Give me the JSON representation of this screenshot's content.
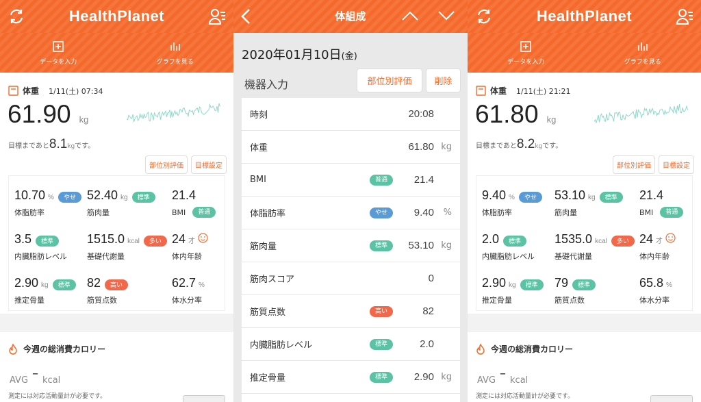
{
  "left": {
    "app_title": "HealthPlanet",
    "tabs": [
      "データを入力",
      "グラフを見る"
    ],
    "weight_label": "体重",
    "weight_time": "1/11(土) 07:34",
    "weight_value": "61.90",
    "weight_unit": "kg",
    "goal_prefix": "目標まであと",
    "goal_value": "8.1",
    "goal_unit": "kg",
    "goal_suffix": "です。",
    "btn_eval": "部位別評価",
    "btn_goal": "目標設定",
    "metrics": [
      {
        "value": "10.70",
        "unit": "%",
        "label": "体脂肪率",
        "badge": "やせ",
        "color": "#5b9bd5"
      },
      {
        "value": "52.40",
        "unit": "kg",
        "label": "筋肉量",
        "badge": "標準",
        "color": "#5cc2a4"
      },
      {
        "value": "21.4",
        "unit": "",
        "label": "BMI",
        "badge": "普通",
        "color": "#5cc2a4"
      },
      {
        "value": "3.5",
        "unit": "",
        "label": "内臓脂肪レベル",
        "badge": "標準",
        "color": "#5cc2a4"
      },
      {
        "value": "1515.0",
        "unit": "kcal",
        "label": "基礎代謝量",
        "badge": "多い",
        "color": "#f1684a"
      },
      {
        "value": "24",
        "unit": "才",
        "label": "体内年齢",
        "badge": "",
        "color": ""
      },
      {
        "value": "2.90",
        "unit": "kg",
        "label": "推定骨量",
        "badge": "標準",
        "color": "#5cc2a4"
      },
      {
        "value": "82",
        "unit": "",
        "label": "筋質点数",
        "badge": "高い",
        "color": "#f1684a"
      },
      {
        "value": "62.7",
        "unit": "%",
        "label": "体水分率",
        "badge": "",
        "color": ""
      }
    ],
    "cal_title": "今週の総消費カロリー",
    "avg_label": "AVG",
    "avg_value": "–",
    "avg_unit": "kcal",
    "cal_note": "測定には対応活動量計が必要です。"
  },
  "middle": {
    "title": "体組成",
    "date": "2020年01月10日",
    "weekday": "(金)",
    "source": "機器入力",
    "btn_eval": "部位別評価",
    "btn_delete": "削除",
    "rows": [
      {
        "label": "時刻",
        "value": "20:08",
        "unit": "",
        "badge": "",
        "color": ""
      },
      {
        "label": "体重",
        "value": "61.80",
        "unit": "kg",
        "badge": "",
        "color": ""
      },
      {
        "label": "BMI",
        "value": "21.4",
        "unit": "",
        "badge": "普通",
        "color": "#5cc2a4"
      },
      {
        "label": "体脂肪率",
        "value": "9.40",
        "unit": "%",
        "badge": "やせ",
        "color": "#5b9bd5"
      },
      {
        "label": "筋肉量",
        "value": "53.10",
        "unit": "kg",
        "badge": "標準",
        "color": "#5cc2a4"
      },
      {
        "label": "筋肉スコア",
        "value": "0",
        "unit": "",
        "badge": "",
        "color": ""
      },
      {
        "label": "筋質点数",
        "value": "82",
        "unit": "",
        "badge": "高い",
        "color": "#f1684a"
      },
      {
        "label": "内臓脂肪レベル",
        "value": "2.0",
        "unit": "",
        "badge": "標準",
        "color": "#5cc2a4"
      },
      {
        "label": "推定骨量",
        "value": "2.90",
        "unit": "kg",
        "badge": "標準",
        "color": "#5cc2a4"
      }
    ]
  },
  "right": {
    "app_title": "HealthPlanet",
    "tabs": [
      "データを入力",
      "グラフを見る"
    ],
    "weight_label": "体重",
    "weight_time": "1/11(土) 21:21",
    "weight_value": "61.80",
    "weight_unit": "kg",
    "goal_prefix": "目標まであと",
    "goal_value": "8.2",
    "goal_unit": "kg",
    "goal_suffix": "です。",
    "btn_eval": "部位別評価",
    "btn_goal": "目標設定",
    "metrics": [
      {
        "value": "9.40",
        "unit": "%",
        "label": "体脂肪率",
        "badge": "やせ",
        "color": "#5b9bd5"
      },
      {
        "value": "53.10",
        "unit": "kg",
        "label": "筋肉量",
        "badge": "標準",
        "color": "#5cc2a4"
      },
      {
        "value": "21.4",
        "unit": "",
        "label": "BMI",
        "badge": "普通",
        "color": "#5cc2a4"
      },
      {
        "value": "2.0",
        "unit": "",
        "label": "内臓脂肪レベル",
        "badge": "標準",
        "color": "#5cc2a4"
      },
      {
        "value": "1535.0",
        "unit": "kcal",
        "label": "基礎代謝量",
        "badge": "多い",
        "color": "#f1684a"
      },
      {
        "value": "24",
        "unit": "才",
        "label": "体内年齢",
        "badge": "",
        "color": ""
      },
      {
        "value": "2.90",
        "unit": "kg",
        "label": "推定骨量",
        "badge": "標準",
        "color": "#5cc2a4"
      },
      {
        "value": "79",
        "unit": "",
        "label": "筋質点数",
        "badge": "標準",
        "color": "#5cc2a4"
      },
      {
        "value": "65.8",
        "unit": "%",
        "label": "体水分率",
        "badge": "",
        "color": ""
      }
    ],
    "cal_title": "今週の総消費カロリー",
    "avg_label": "AVG",
    "avg_value": "–",
    "avg_unit": "kcal",
    "cal_note": "測定には対応活動量計が必要です。"
  },
  "colors": {
    "accent": "#f46a2c",
    "blue": "#5b9bd5",
    "teal": "#5cc2a4",
    "red": "#f1684a"
  }
}
